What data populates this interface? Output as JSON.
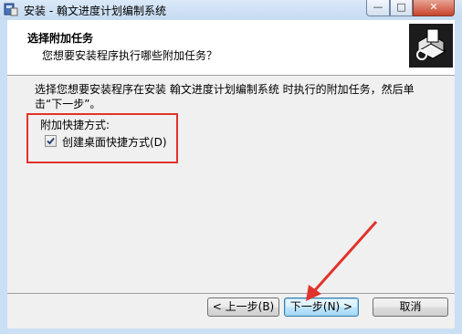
{
  "window": {
    "title": "安装 - 翰文进度计划编制系统",
    "minimize_glyph": "—",
    "maximize_glyph": "□",
    "close_glyph": "✕",
    "icons": [
      "installer-app-icon",
      "setup-box-icon"
    ]
  },
  "header": {
    "title": "选择附加任务",
    "subtitle": "您想要安装程序执行哪些附加任务？"
  },
  "body": {
    "description": "选择您想要安装程序在安装 翰文进度计划编制系统 时执行的附加任务，然后单击“下一步”。",
    "group_label": "附加快捷方式:",
    "checkbox_label": "创建桌面快捷方式(D)",
    "checkbox_checked": true
  },
  "footer": {
    "back_label": "< 上一步(B)",
    "next_label": "下一步(N) >",
    "cancel_label": "取消"
  },
  "annotation": {
    "highlight_color": "#e0332b",
    "arrow_color": "#e0332b"
  }
}
